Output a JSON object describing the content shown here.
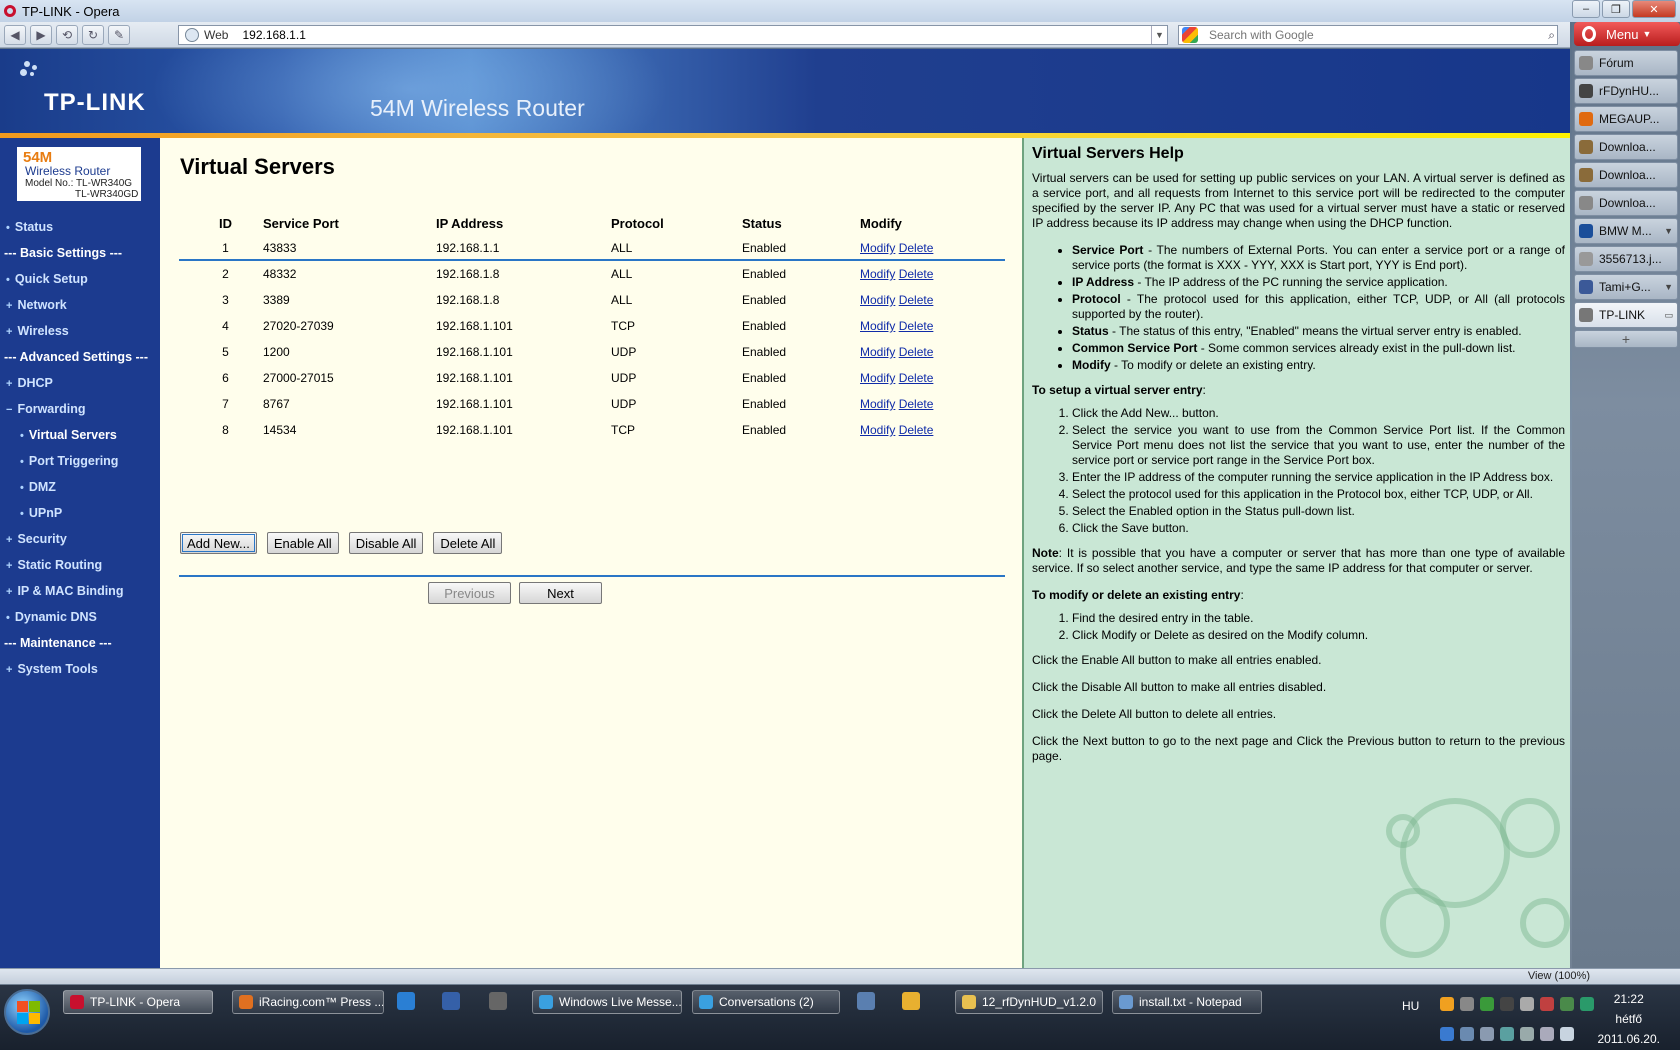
{
  "window": {
    "title": "TP-LINK - Opera"
  },
  "toolbar": {
    "address_prefix": "Web",
    "url": "192.168.1.1",
    "search_placeholder": "Search with Google"
  },
  "opera": {
    "menu_label": "Menu",
    "tabs": [
      {
        "label": "Fórum",
        "color": "#888888"
      },
      {
        "label": "rFDynHU...",
        "color": "#444444"
      },
      {
        "label": "MEGAUP...",
        "color": "#e06a10"
      },
      {
        "label": "Downloa...",
        "color": "#8a6b3a"
      },
      {
        "label": "Downloa...",
        "color": "#8a6b3a"
      },
      {
        "label": "Downloa...",
        "color": "#888888"
      },
      {
        "label": "BMW M...",
        "color": "#1b4e9a"
      },
      {
        "label": "3556713.j...",
        "color": "#999999"
      },
      {
        "label": "Tami+G...",
        "color": "#3b5998"
      },
      {
        "label": "TP-LINK",
        "color": "#777777"
      }
    ]
  },
  "router": {
    "brand": "TP-LINK",
    "banner_title": "54M Wireless Router",
    "model": {
      "speed": "54M",
      "type": "Wireless Router",
      "model_line1": "Model No.: TL-WR340G",
      "model_line2": "TL-WR340GD"
    },
    "nav": [
      {
        "label": "Status",
        "kind": "item"
      },
      {
        "label": "--- Basic Settings ---",
        "kind": "head"
      },
      {
        "label": "Quick Setup",
        "kind": "item"
      },
      {
        "label": "Network",
        "kind": "item"
      },
      {
        "label": "Wireless",
        "kind": "item"
      },
      {
        "label": "--- Advanced Settings ---",
        "kind": "head"
      },
      {
        "label": "DHCP",
        "kind": "item"
      },
      {
        "label": "Forwarding",
        "kind": "item"
      },
      {
        "label": "Virtual Servers",
        "kind": "sub-active"
      },
      {
        "label": "Port Triggering",
        "kind": "sub"
      },
      {
        "label": "DMZ",
        "kind": "sub"
      },
      {
        "label": "UPnP",
        "kind": "sub"
      },
      {
        "label": "Security",
        "kind": "item"
      },
      {
        "label": "Static Routing",
        "kind": "item"
      },
      {
        "label": "IP & MAC Binding",
        "kind": "item"
      },
      {
        "label": "Dynamic DNS",
        "kind": "item"
      },
      {
        "label": "--- Maintenance ---",
        "kind": "head"
      },
      {
        "label": "System Tools",
        "kind": "item"
      }
    ],
    "page_title": "Virtual Servers",
    "table": {
      "headers": [
        "ID",
        "Service Port",
        "IP Address",
        "Protocol",
        "Status",
        "Modify"
      ],
      "rows": [
        {
          "id": "1",
          "port": "43833",
          "ip": "192.168.1.1",
          "protocol": "ALL",
          "status": "Enabled"
        },
        {
          "id": "2",
          "port": "48332",
          "ip": "192.168.1.8",
          "protocol": "ALL",
          "status": "Enabled"
        },
        {
          "id": "3",
          "port": "3389",
          "ip": "192.168.1.8",
          "protocol": "ALL",
          "status": "Enabled"
        },
        {
          "id": "4",
          "port": "27020-27039",
          "ip": "192.168.1.101",
          "protocol": "TCP",
          "status": "Enabled"
        },
        {
          "id": "5",
          "port": "1200",
          "ip": "192.168.1.101",
          "protocol": "UDP",
          "status": "Enabled"
        },
        {
          "id": "6",
          "port": "27000-27015",
          "ip": "192.168.1.101",
          "protocol": "UDP",
          "status": "Enabled"
        },
        {
          "id": "7",
          "port": "8767",
          "ip": "192.168.1.101",
          "protocol": "UDP",
          "status": "Enabled"
        },
        {
          "id": "8",
          "port": "14534",
          "ip": "192.168.1.101",
          "protocol": "TCP",
          "status": "Enabled"
        }
      ],
      "modify_label": "Modify",
      "delete_label": "Delete"
    },
    "buttons": {
      "add_new": "Add New...",
      "enable_all": "Enable All",
      "disable_all": "Disable All",
      "delete_all": "Delete All",
      "previous": "Previous",
      "next": "Next"
    },
    "help": {
      "title": "Virtual Servers Help",
      "intro": "Virtual servers can be used for setting up public services on your LAN. A virtual server is defined as a service port, and all requests from Internet to this service port will be redirected to the computer specified by the server IP. Any PC that was used for a virtual server must have a static or reserved IP address because its IP address may change when using the DHCP function.",
      "fields": [
        {
          "term": "Service Port",
          "text": " - The numbers of External Ports. You can enter a service port or a range of service ports (the format is XXX - YYY, XXX is Start port, YYY is End port)."
        },
        {
          "term": "IP Address",
          "text": " - The IP address of the PC running the service application."
        },
        {
          "term": "Protocol",
          "text": " - The protocol used for this application, either TCP, UDP, or All (all protocols supported by the router)."
        },
        {
          "term": "Status",
          "text": " - The status of this entry, \"Enabled\" means the virtual server entry is enabled."
        },
        {
          "term": "Common Service Port",
          "text": " - Some common services already exist in the pull-down list."
        },
        {
          "term": "Modify",
          "text": " - To modify or delete an existing entry."
        }
      ],
      "setup_heading": "To setup a virtual server entry",
      "setup_steps": [
        "Click the Add New... button.",
        "Select the service you want to use from the Common Service Port list. If the Common Service Port menu does not list the service that you want to use, enter the number of the service port or service port range in the Service Port box.",
        "Enter the IP address of the computer running the service application in the IP Address box.",
        "Select the protocol used for this application in the Protocol box, either TCP, UDP, or All.",
        "Select the Enabled option in the Status pull-down list.",
        "Click the Save button."
      ],
      "note_label": "Note",
      "note": ": It is possible that you have a computer or server that has more than one type of available service. If so select another service, and type the same IP address for that computer or server.",
      "modify_heading": "To modify or delete an existing entry",
      "modify_steps": [
        "Find the desired entry in the table.",
        "Click Modify or Delete as desired on the Modify column."
      ],
      "enable_all_text": "Click the Enable All button to make all entries enabled.",
      "disable_all_text": "Click the Disable All button to make all entries disabled.",
      "delete_all_text": "Click the Delete All button to delete all entries.",
      "pager_text": "Click the Next button to go to the next page and Click the Previous button to return to the previous page."
    }
  },
  "statusbar": {
    "zoom": "View (100%)"
  },
  "taskbar": {
    "items": [
      {
        "label": "TP-LINK - Opera",
        "color": "#c8102e"
      },
      {
        "label": "iRacing.com™ Press ...",
        "color": "#e07020"
      },
      {
        "label": "Windows Live Messe...",
        "color": "#3aa0e0"
      },
      {
        "label": "Conversations (2)",
        "color": "#3aa0e0"
      },
      {
        "label": "12_rfDynHUD_v1.2.0",
        "color": "#e8c050"
      },
      {
        "label": "install.txt - Notepad",
        "color": "#6a9ad0"
      }
    ],
    "language": "HU",
    "time": "21:22",
    "day": "hétfő",
    "date": "2011.06.20."
  }
}
